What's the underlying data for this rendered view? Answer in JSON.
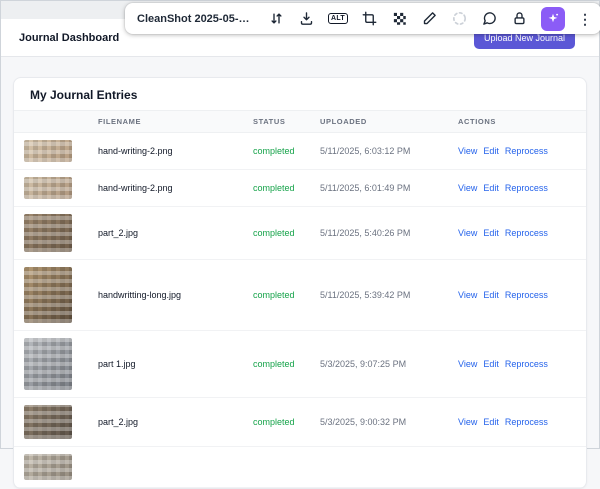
{
  "toolbar": {
    "title": "CleanShot 2025-05-1…",
    "alt_label": "ALT",
    "icons": [
      "resize-arrows-icon",
      "download-icon",
      "alt-badge",
      "crop-icon",
      "pixelate-icon",
      "pencil-icon",
      "spinner-circle-icon",
      "comment-icon",
      "lock-icon",
      "magic-wand-button",
      "more-menu-icon"
    ]
  },
  "header": {
    "title": "Journal Dashboard",
    "upload_button": "Upload New Journal"
  },
  "main": {
    "section_title": "My Journal Entries",
    "table": {
      "columns": [
        "FILENAME",
        "STATUS",
        "UPLOADED",
        "ACTIONS"
      ],
      "rows": [
        {
          "filename": "hand-writing-2.png",
          "status": "completed",
          "uploaded": "5/11/2025, 6:03:12 PM",
          "actions": [
            "View",
            "Edit",
            "Reprocess"
          ],
          "thumb": "small-tan"
        },
        {
          "filename": "hand-writing-2.png",
          "status": "completed",
          "uploaded": "5/11/2025, 6:01:49 PM",
          "actions": [
            "View",
            "Edit",
            "Reprocess"
          ],
          "thumb": "small-tan2"
        },
        {
          "filename": "part_2.jpg",
          "status": "completed",
          "uploaded": "5/11/2025, 5:40:26 PM",
          "actions": [
            "View",
            "Edit",
            "Reprocess"
          ],
          "thumb": "medium-brown"
        },
        {
          "filename": "handwritting-long.jpg",
          "status": "completed",
          "uploaded": "5/11/2025, 5:39:42 PM",
          "actions": [
            "View",
            "Edit",
            "Reprocess"
          ],
          "thumb": "large-brown"
        },
        {
          "filename": "part 1.jpg",
          "status": "completed",
          "uploaded": "5/3/2025, 9:07:25 PM",
          "actions": [
            "View",
            "Edit",
            "Reprocess"
          ],
          "thumb": "medium-gray"
        },
        {
          "filename": "part_2.jpg",
          "status": "completed",
          "uploaded": "5/3/2025, 9:00:32 PM",
          "actions": [
            "View",
            "Edit",
            "Reprocess"
          ],
          "thumb": "medium-brown2"
        },
        {
          "filename": "",
          "status": "",
          "uploaded": "",
          "actions": [],
          "thumb": "partial-gray"
        }
      ]
    }
  },
  "colors": {
    "accent_purple": "#5b57d6",
    "wand_purple": "#8b5cf6",
    "status_green": "#16a34a",
    "link_blue": "#2563eb"
  }
}
